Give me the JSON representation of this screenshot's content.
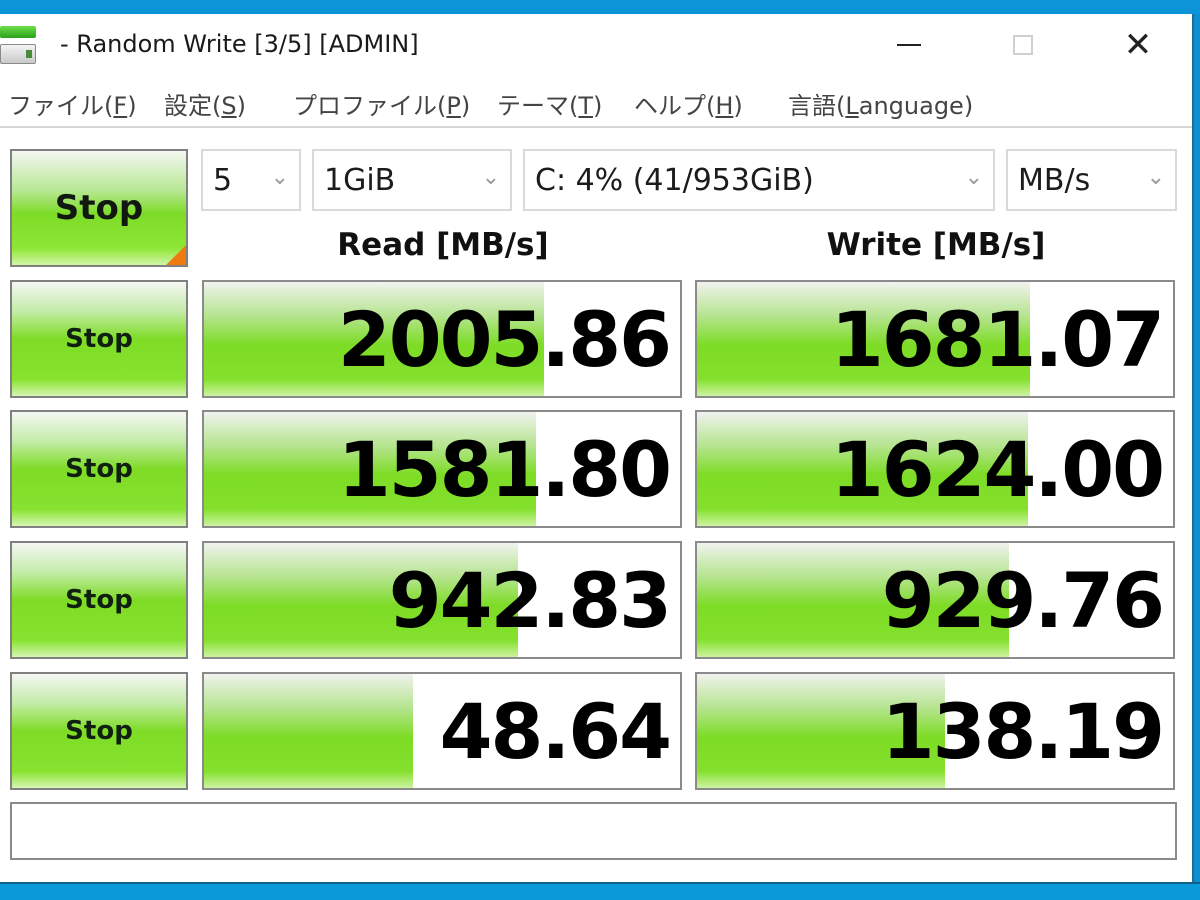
{
  "window": {
    "title": "- Random Write [3/5] [ADMIN]",
    "controls": {
      "minimize": "minimize",
      "maximize": "maximize",
      "close": "✕"
    }
  },
  "menu": [
    {
      "label": "ファイル(",
      "acc": "F",
      "tail": ")"
    },
    {
      "label": "設定(",
      "acc": "S",
      "tail": ")"
    },
    {
      "label": "プロファイル(",
      "acc": "P",
      "tail": ")"
    },
    {
      "label": "テーマ(",
      "acc": "T",
      "tail": ")"
    },
    {
      "label": "ヘルプ(",
      "acc": "H",
      "tail": ")"
    },
    {
      "label": "言語(",
      "acc": "L",
      "tail": "anguage)"
    }
  ],
  "controls": {
    "main_button": "Stop",
    "count": {
      "value": "5",
      "chevron": "⌄"
    },
    "size": {
      "value": "1GiB",
      "chevron": "⌄"
    },
    "drive": {
      "value": "C: 4% (41/953GiB)",
      "chevron": "⌄"
    },
    "unit": {
      "value": "MB/s",
      "chevron": "⌄"
    }
  },
  "headers": {
    "read": "Read [MB/s]",
    "write": "Write [MB/s]"
  },
  "accent": {
    "green": "#7ddc26",
    "orange_corner": "#ef7a12",
    "border": "#808080"
  },
  "rows": [
    {
      "button": "Stop",
      "read": "2005.86",
      "read_fill": 0.715,
      "write": "1681.07",
      "write_fill": 0.7
    },
    {
      "button": "Stop",
      "read": "1581.80",
      "read_fill": 0.698,
      "write": "1624.00",
      "write_fill": 0.695
    },
    {
      "button": "Stop",
      "read": "942.83",
      "read_fill": 0.66,
      "write": "929.76",
      "write_fill": 0.655
    },
    {
      "button": "Stop",
      "read": "48.64",
      "read_fill": 0.44,
      "write": "138.19",
      "write_fill": 0.52
    }
  ],
  "status": ""
}
